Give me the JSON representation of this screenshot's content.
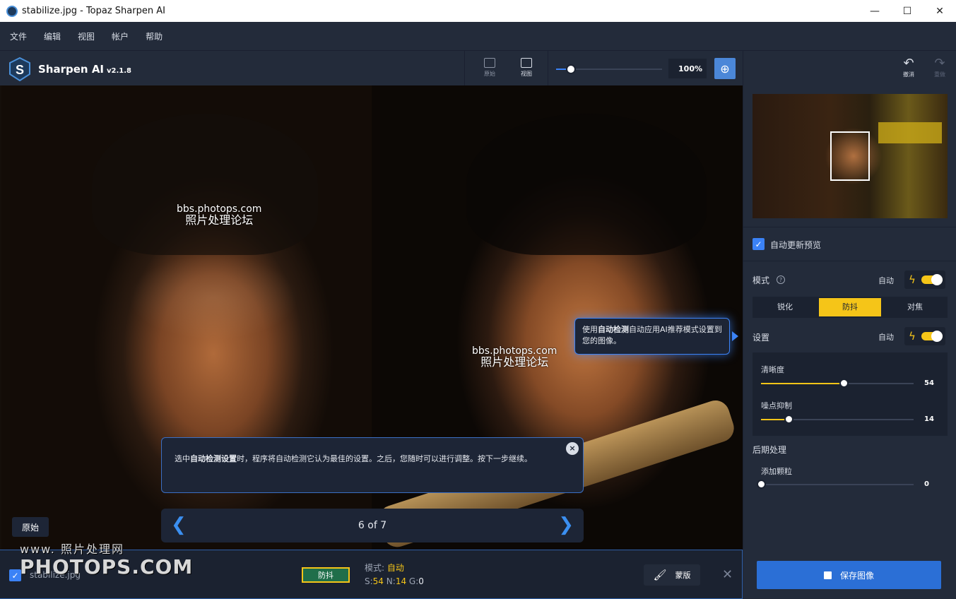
{
  "window": {
    "title": "stabilize.jpg - Topaz Sharpen AI",
    "minimize": "—",
    "maximize": "☐",
    "close": "✕"
  },
  "menu": [
    "文件",
    "编辑",
    "视图",
    "帐户",
    "帮助"
  ],
  "app": {
    "name": "Sharpen AI",
    "version": "v2.1.8"
  },
  "toolbar": {
    "original_label": "原始",
    "view_label": "视图",
    "zoom_value": "100%",
    "undo_label": "撤消",
    "redo_label": "重做"
  },
  "viewer": {
    "watermark_url": "bbs.photops.com",
    "watermark_cn": "照片处理论坛",
    "original_button": "原始",
    "callout": {
      "prefix": "使用",
      "bold": "自动检测",
      "suffix": "自动应用AI推荐模式设置到您的图像。"
    },
    "tip": {
      "prefix": "选中",
      "bold": "自动检测设置",
      "suffix": "时，程序将自动检测它认为最佳的设置。之后，您随时可以进行调整。按下一步继续。",
      "close": "×"
    },
    "step_nav": {
      "text": "6 of 7",
      "prev": "❮",
      "next": "❯"
    }
  },
  "sidebar": {
    "auto_update_label": "自动更新预览",
    "mode_label": "模式",
    "mode_auto": "自动",
    "modes": [
      "锐化",
      "防抖",
      "对焦"
    ],
    "active_mode": "防抖",
    "settings_label": "设置",
    "settings_auto": "自动",
    "clarity": {
      "label": "清晰度",
      "value": 54,
      "fraction": 0.54
    },
    "noise": {
      "label": "噪点抑制",
      "value": 14,
      "fraction": 0.18
    },
    "post_label": "后期处理",
    "grain": {
      "label": "添加颗粒",
      "value": 0,
      "fraction": 0.0
    }
  },
  "bottombar": {
    "filename": "stabilize.jpg",
    "mode_chip": "防抖",
    "mode_prefix": "模式: ",
    "mode_value": "自动",
    "s_label": "S:",
    "s_value": "54",
    "n_label": "N:",
    "n_value": "14",
    "g_label": "G:",
    "g_value": "0",
    "mask_label": "蒙版",
    "remove": "✕",
    "save_label": "保存图像"
  },
  "overlay_watermark": {
    "top": "www.  照片处理网",
    "big": "PHOTOPS.COM"
  },
  "colors": {
    "accent": "#2b6fd6",
    "highlight": "#f5c518",
    "panel": "#232b3a",
    "bg": "#1b2230"
  }
}
